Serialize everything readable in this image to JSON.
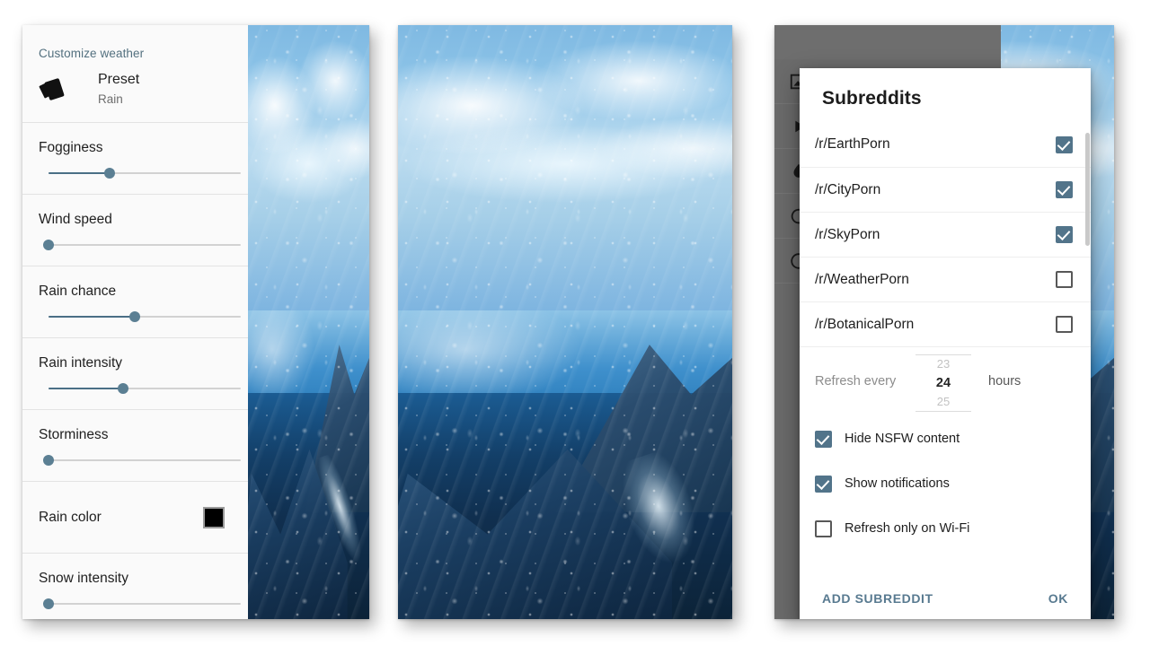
{
  "panel_customize": {
    "section_title": "Customize weather",
    "preset": {
      "icon": "preset-cards-icon",
      "title": "Preset",
      "value": "Rain"
    },
    "sliders": [
      {
        "label": "Fogginess",
        "value": 32
      },
      {
        "label": "Wind speed",
        "value": 0
      },
      {
        "label": "Rain chance",
        "value": 45
      },
      {
        "label": "Rain intensity",
        "value": 39
      },
      {
        "label": "Storminess",
        "value": 0
      },
      {
        "label": "Snow intensity",
        "value": 0
      }
    ],
    "color_setting": {
      "label": "Rain color",
      "swatch_hex": "#000000"
    },
    "accent_hex": "#53707f",
    "slider_fill_hex": "#4a6f86",
    "knob_hex": "#5b7f93"
  },
  "panel_wallpaper": {
    "image_description": "Rain drops on window with snowy mountain and blue sky"
  },
  "panel_subreddits": {
    "background_rows": [
      {
        "icon": "image-icon"
      },
      {
        "icon": "play-icon"
      },
      {
        "icon": "droplet-icon"
      },
      {
        "icon": "refresh-icon"
      },
      {
        "icon": "circle-icon"
      }
    ],
    "dialog": {
      "title": "Subreddits",
      "subreddits": [
        {
          "name": "/r/EarthPorn",
          "checked": true
        },
        {
          "name": "/r/CityPorn",
          "checked": true
        },
        {
          "name": "/r/SkyPorn",
          "checked": true
        },
        {
          "name": "/r/WeatherPorn",
          "checked": false
        },
        {
          "name": "/r/BotanicalPorn",
          "checked": false
        }
      ],
      "refresh": {
        "label": "Refresh every",
        "prev": "23",
        "current": "24",
        "next": "25",
        "unit": "hours"
      },
      "options": [
        {
          "label": "Hide NSFW content",
          "checked": true
        },
        {
          "label": "Show notifications",
          "checked": true
        },
        {
          "label": "Refresh only on Wi-Fi",
          "checked": false
        }
      ],
      "buttons": {
        "add": "ADD SUBREDDIT",
        "ok": "OK"
      },
      "button_hex": "#587a90",
      "checkbox_hex": "#52748a"
    }
  }
}
